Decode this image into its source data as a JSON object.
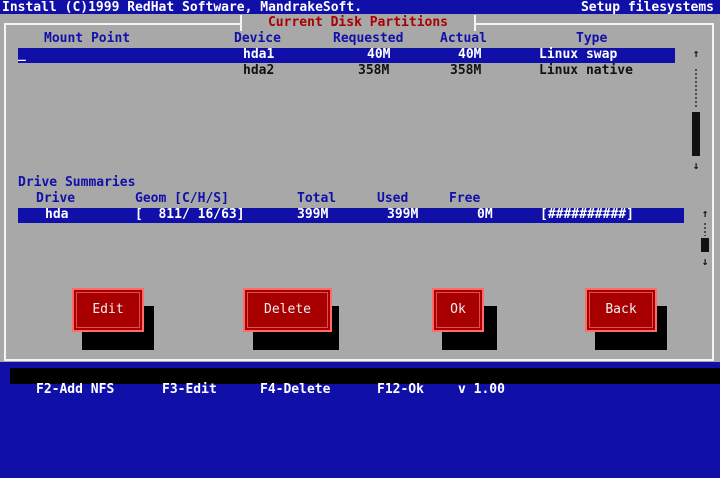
{
  "topbar": {
    "left": "Install (C)1999 RedHat Software, MandrakeSoft.",
    "right": "Setup filesystems"
  },
  "dialog": {
    "title": "Current Disk Partitions"
  },
  "partitions": {
    "headers": {
      "mount": "Mount Point",
      "device": "Device",
      "requested": "Requested",
      "actual": "Actual",
      "type": "Type"
    },
    "rows": [
      {
        "mount": "_",
        "device": "hda1",
        "requested": "40M",
        "actual": "40M",
        "type": "Linux swap",
        "selected": true
      },
      {
        "mount": "",
        "device": "hda2",
        "requested": "358M",
        "actual": "358M",
        "type": "Linux native",
        "selected": false
      }
    ]
  },
  "drives": {
    "section_title": "Drive Summaries",
    "headers": {
      "drive": "Drive",
      "geom": "Geom [C/H/S]",
      "total": "Total",
      "used": "Used",
      "free": "Free"
    },
    "rows": [
      {
        "drive": "hda",
        "geom": "[  811/ 16/63]",
        "total": "399M",
        "used": "399M",
        "free": "0M",
        "bar": "[##########]"
      }
    ]
  },
  "scroll": {
    "up": "↑",
    "down": "↓"
  },
  "buttons": {
    "edit": "Edit",
    "delete": "Delete",
    "ok": "Ok",
    "back": "Back"
  },
  "help": {
    "f2": "F2-Add NFS",
    "f3": "F3-Edit",
    "f4": "F4-Delete",
    "f12": "F12-Ok",
    "version": "v 1.00"
  },
  "colors": {
    "background": "#1010a8",
    "dialog": "#a8a8a8",
    "button": "#a80000",
    "title": "#a80000",
    "selection": "#1010a8"
  }
}
